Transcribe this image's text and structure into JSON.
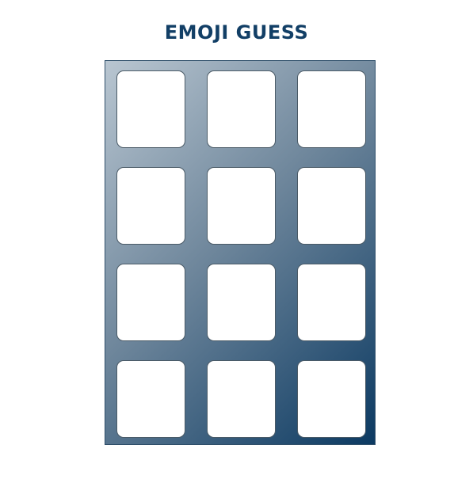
{
  "game": {
    "title": "EMOJI GUESS",
    "rows": 4,
    "columns": 3,
    "cards": [
      {
        "face": ""
      },
      {
        "face": ""
      },
      {
        "face": ""
      },
      {
        "face": ""
      },
      {
        "face": ""
      },
      {
        "face": ""
      },
      {
        "face": ""
      },
      {
        "face": ""
      },
      {
        "face": ""
      },
      {
        "face": ""
      },
      {
        "face": ""
      },
      {
        "face": ""
      }
    ]
  },
  "colors": {
    "title": "#123f66",
    "board_gradient_start": "#b9c6d1",
    "board_gradient_end": "#0c3a62",
    "card_face": "#ffffff"
  }
}
